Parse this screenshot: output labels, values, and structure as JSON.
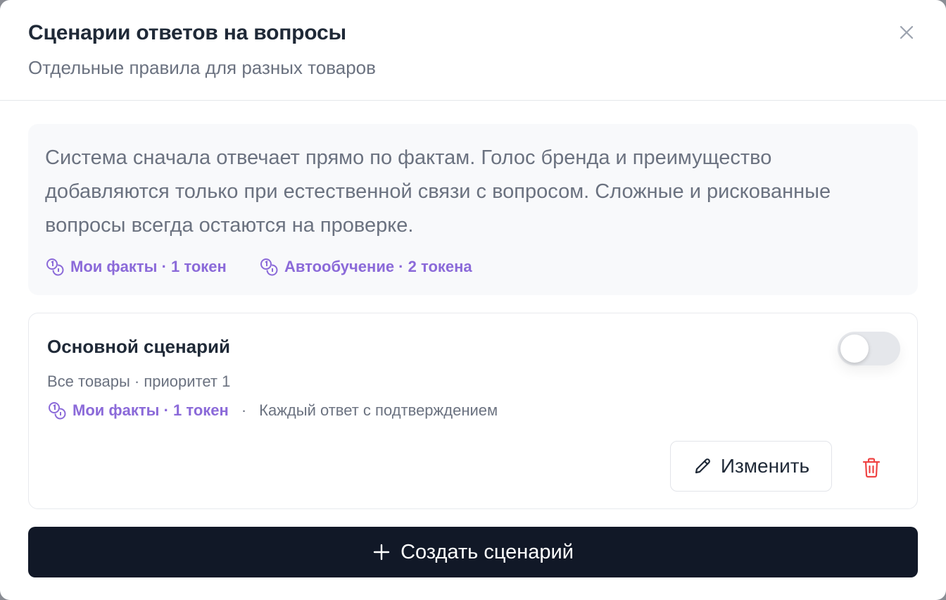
{
  "header": {
    "title": "Сценарии ответов на вопросы",
    "subtitle": "Отдельные правила для разных товаров"
  },
  "info": {
    "text": "Система сначала отвечает прямо по фактам. Голос бренда и преимущество добавляются только при естественной связи с вопросом. Сложные и рискованные вопросы всегда остаются на проверке.",
    "tags": [
      {
        "label": "Мои факты · 1 токен",
        "icon": "coins-icon"
      },
      {
        "label": "Автообучение · 2 токена",
        "icon": "coins-icon"
      }
    ]
  },
  "scenario": {
    "title": "Основной сценарий",
    "meta": "Все товары · приоритет 1",
    "tag": "Мои факты · 1 токен",
    "separator": "·",
    "mode": "Каждый ответ с подтверждением",
    "enabled": false,
    "edit_label": "Изменить"
  },
  "create_label": "Создать сценарий",
  "colors": {
    "accent": "#8b6ad9",
    "primary_button": "#111827",
    "danger": "#ef4444"
  }
}
